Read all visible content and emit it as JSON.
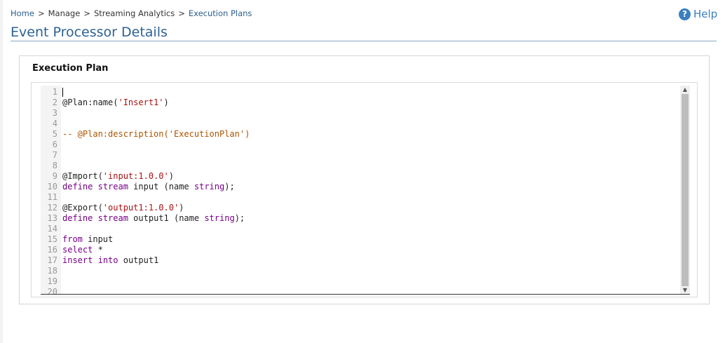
{
  "breadcrumb": {
    "home": "Home",
    "manage": "Manage",
    "streaming": "Streaming Analytics",
    "plans": "Execution Plans",
    "separator": ">"
  },
  "help": {
    "icon": "question-circle-icon",
    "label": "Help"
  },
  "page_title": "Event Processor Details",
  "panel": {
    "title": "Execution Plan"
  },
  "editor": {
    "lines": [
      {
        "n": "1",
        "tokens": [],
        "cursor": true
      },
      {
        "n": "2",
        "tokens": [
          {
            "t": "@Plan:name(",
            "c": "plain"
          },
          {
            "t": "'Insert1'",
            "c": "str"
          },
          {
            "t": ")",
            "c": "plain"
          }
        ]
      },
      {
        "n": "3",
        "tokens": []
      },
      {
        "n": "4",
        "tokens": []
      },
      {
        "n": "5",
        "tokens": [
          {
            "t": "-- @Plan:description('ExecutionPlan')",
            "c": "comment"
          }
        ]
      },
      {
        "n": "6",
        "tokens": []
      },
      {
        "n": "7",
        "tokens": []
      },
      {
        "n": "8",
        "tokens": []
      },
      {
        "n": "9",
        "tokens": [
          {
            "t": "@Import(",
            "c": "plain"
          },
          {
            "t": "'input:1.0.0'",
            "c": "str"
          },
          {
            "t": ")",
            "c": "plain"
          }
        ]
      },
      {
        "n": "10",
        "tokens": [
          {
            "t": "define",
            "c": "kw"
          },
          {
            "t": " ",
            "c": "plain"
          },
          {
            "t": "stream",
            "c": "kw"
          },
          {
            "t": " input (name ",
            "c": "plain"
          },
          {
            "t": "string",
            "c": "kw"
          },
          {
            "t": ");",
            "c": "plain"
          }
        ]
      },
      {
        "n": "11",
        "tokens": []
      },
      {
        "n": "12",
        "tokens": [
          {
            "t": "@Export(",
            "c": "plain"
          },
          {
            "t": "'output1:1.0.0'",
            "c": "str"
          },
          {
            "t": ")",
            "c": "plain"
          }
        ]
      },
      {
        "n": "13",
        "tokens": [
          {
            "t": "define",
            "c": "kw"
          },
          {
            "t": " ",
            "c": "plain"
          },
          {
            "t": "stream",
            "c": "kw"
          },
          {
            "t": " output1 (name ",
            "c": "plain"
          },
          {
            "t": "string",
            "c": "kw"
          },
          {
            "t": ");",
            "c": "plain"
          }
        ]
      },
      {
        "n": "14",
        "tokens": []
      },
      {
        "n": "15",
        "tokens": [
          {
            "t": "from",
            "c": "kw"
          },
          {
            "t": " input",
            "c": "plain"
          }
        ]
      },
      {
        "n": "16",
        "tokens": [
          {
            "t": "select",
            "c": "kw"
          },
          {
            "t": " *",
            "c": "plain"
          }
        ]
      },
      {
        "n": "17",
        "tokens": [
          {
            "t": "insert",
            "c": "kw"
          },
          {
            "t": " ",
            "c": "plain"
          },
          {
            "t": "into",
            "c": "kw"
          },
          {
            "t": " output1",
            "c": "plain"
          }
        ]
      },
      {
        "n": "18",
        "tokens": []
      },
      {
        "n": "19",
        "tokens": []
      },
      {
        "n": "20",
        "tokens": []
      }
    ]
  },
  "colors": {
    "accent": "#2d6290",
    "help": "#3a7fc0",
    "string": "#a11",
    "keyword": "#708",
    "comment": "#a50"
  }
}
